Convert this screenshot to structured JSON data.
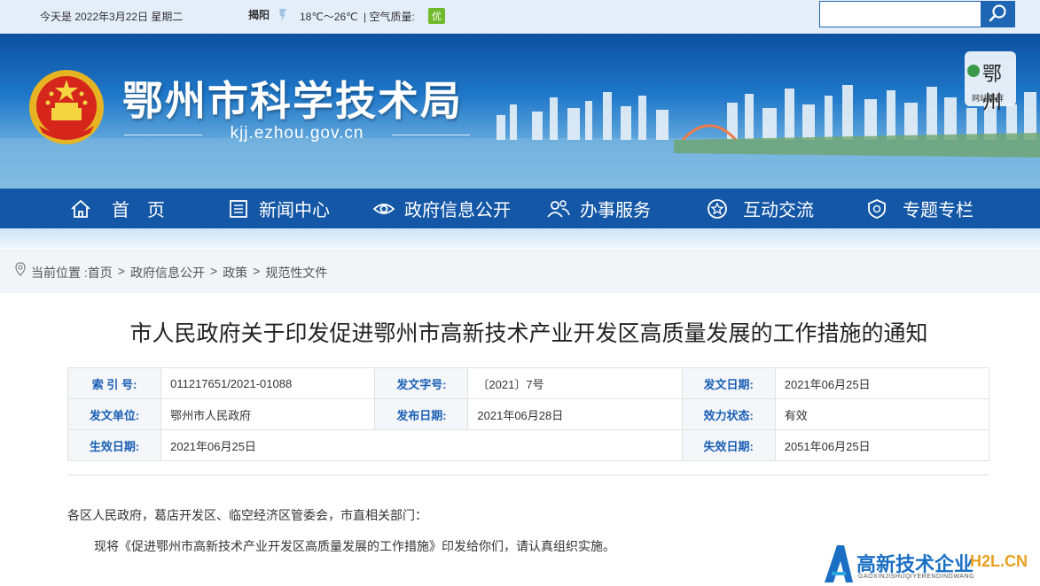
{
  "topbar": {
    "date": "今天是 2022年3月22日 星期二",
    "city": "揭阳",
    "temperature": "18℃～26℃",
    "air_quality_label": "| 空气质量:",
    "air_quality_value": "优",
    "search_placeholder": "",
    "weather_icon": "weather-icon",
    "search_icon": "magnifier-icon"
  },
  "banner": {
    "title": "鄂州市科学技术局",
    "url": "kjj.ezhou.gov.cn",
    "logo_text": "鄂州",
    "logo_subtext": "网站集群"
  },
  "nav": {
    "items": [
      {
        "label": "首　页",
        "icon": "home-icon"
      },
      {
        "label": "新闻中心",
        "icon": "news-icon"
      },
      {
        "label": "政府信息公开",
        "icon": "eye-icon"
      },
      {
        "label": "办事服务",
        "icon": "people-icon"
      },
      {
        "label": "互动交流",
        "icon": "star-icon"
      },
      {
        "label": "专题专栏",
        "icon": "shield-icon"
      }
    ]
  },
  "breadcrumb": {
    "prefix": "当前位置 :",
    "items": [
      "首页",
      "政府信息公开",
      "政策",
      "规范性文件"
    ],
    "separator": ">"
  },
  "document": {
    "title": "市人民政府关于印发促进鄂州市高新技术产业开发区高质量发展的工作措施的通知",
    "meta": [
      [
        {
          "key": "索 引 号:",
          "value": "011217651/2021-01088"
        },
        {
          "key": "发文字号:",
          "value": "〔2021〕7号"
        },
        {
          "key": "发文日期:",
          "value": "2021年06月25日"
        }
      ],
      [
        {
          "key": "发文单位:",
          "value": "鄂州市人民政府"
        },
        {
          "key": "发布日期:",
          "value": "2021年06月28日"
        },
        {
          "key": "效力状态:",
          "value": "有效"
        }
      ],
      [
        {
          "key": "生效日期:",
          "value": "2021年06月25日"
        },
        {
          "key": "",
          "value": ""
        },
        {
          "key": "失效日期:",
          "value": "2051年06月25日"
        }
      ]
    ],
    "paragraphs": [
      "各区人民政府，葛店开发区、临空经济区管委会，市直相关部门：",
      "现将《促进鄂州市高新技术产业开发区高质量发展的工作措施》印发给你们，请认真组织实施。"
    ]
  },
  "watermark": {
    "title": "高新技术企业",
    "brand": "H2L.CN",
    "sub": "GAOXINJISHUQIYERENDINGWANG"
  },
  "colors": {
    "nav_bg": "#1457a6",
    "accent": "#1a5fb4",
    "good": "#6fb92c"
  }
}
